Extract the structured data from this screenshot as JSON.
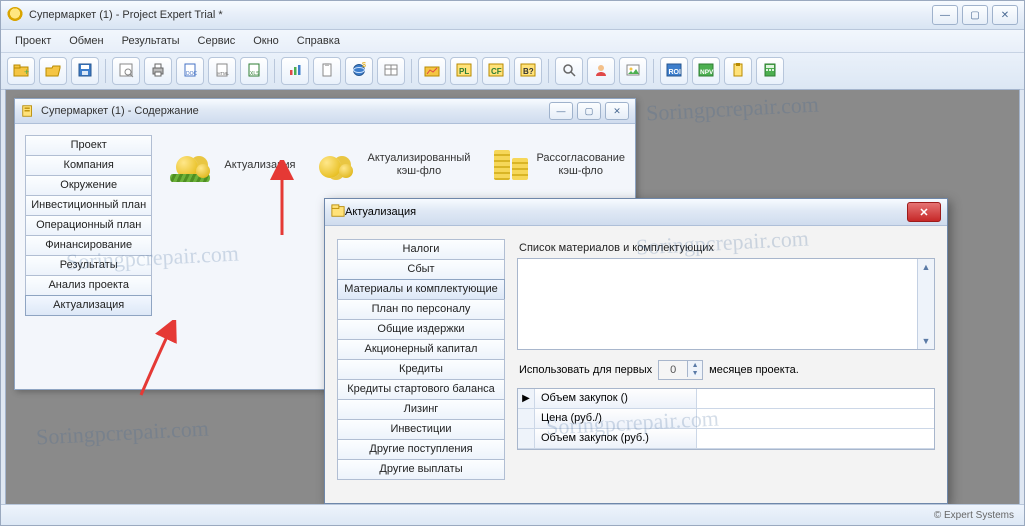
{
  "window": {
    "title": "Супермаркет (1) - Project Expert Trial *",
    "min": "—",
    "max": "▢",
    "close": "✕"
  },
  "menu": [
    "Проект",
    "Обмен",
    "Результаты",
    "Сервис",
    "Окно",
    "Справка"
  ],
  "toolbar_icons": [
    "folder-plus",
    "folder-open",
    "save",
    "separator",
    "preview",
    "print",
    "doc",
    "html",
    "xls",
    "separator",
    "barchart",
    "clipboard",
    "globe",
    "table",
    "separator",
    "chart-folder",
    "pl",
    "cf",
    "bf",
    "separator",
    "zoom",
    "user",
    "image",
    "separator",
    "roi",
    "npv",
    "clipboard2",
    "calc"
  ],
  "content_window": {
    "title": "Супермаркет (1) - Содержание",
    "nav": [
      "Проект",
      "Компания",
      "Окружение",
      "Инвестиционный план",
      "Операционный план",
      "Финансирование",
      "Результаты",
      "Анализ проекта",
      "Актуализация"
    ],
    "selected_nav_index": 8,
    "items": [
      {
        "label": "Актуализация"
      },
      {
        "label": "Актуализированный\nкэш-фло"
      },
      {
        "label": "Рассогласование\nкэш-фло"
      }
    ]
  },
  "dialog": {
    "title": "Актуализация",
    "nav": [
      "Налоги",
      "Сбыт",
      "Материалы и комплектующие",
      "План по персоналу",
      "Общие издержки",
      "Акционерный капитал",
      "Кредиты",
      "Кредиты стартового баланса",
      "Лизинг",
      "Инвестиции",
      "Другие поступления",
      "Другие выплаты"
    ],
    "selected_nav_index": 2,
    "list_label": "Список материалов и комплектующих",
    "use_label_before": "Использовать для первых",
    "use_value": "0",
    "use_label_after": "месяцев проекта.",
    "grid_rows": [
      "Объем закупок ()",
      "Цена (руб./)",
      "Объем закупок (руб.)"
    ]
  },
  "statusbar": {
    "text": "© Expert Systems"
  },
  "watermark": "Soringpcrepair.com"
}
